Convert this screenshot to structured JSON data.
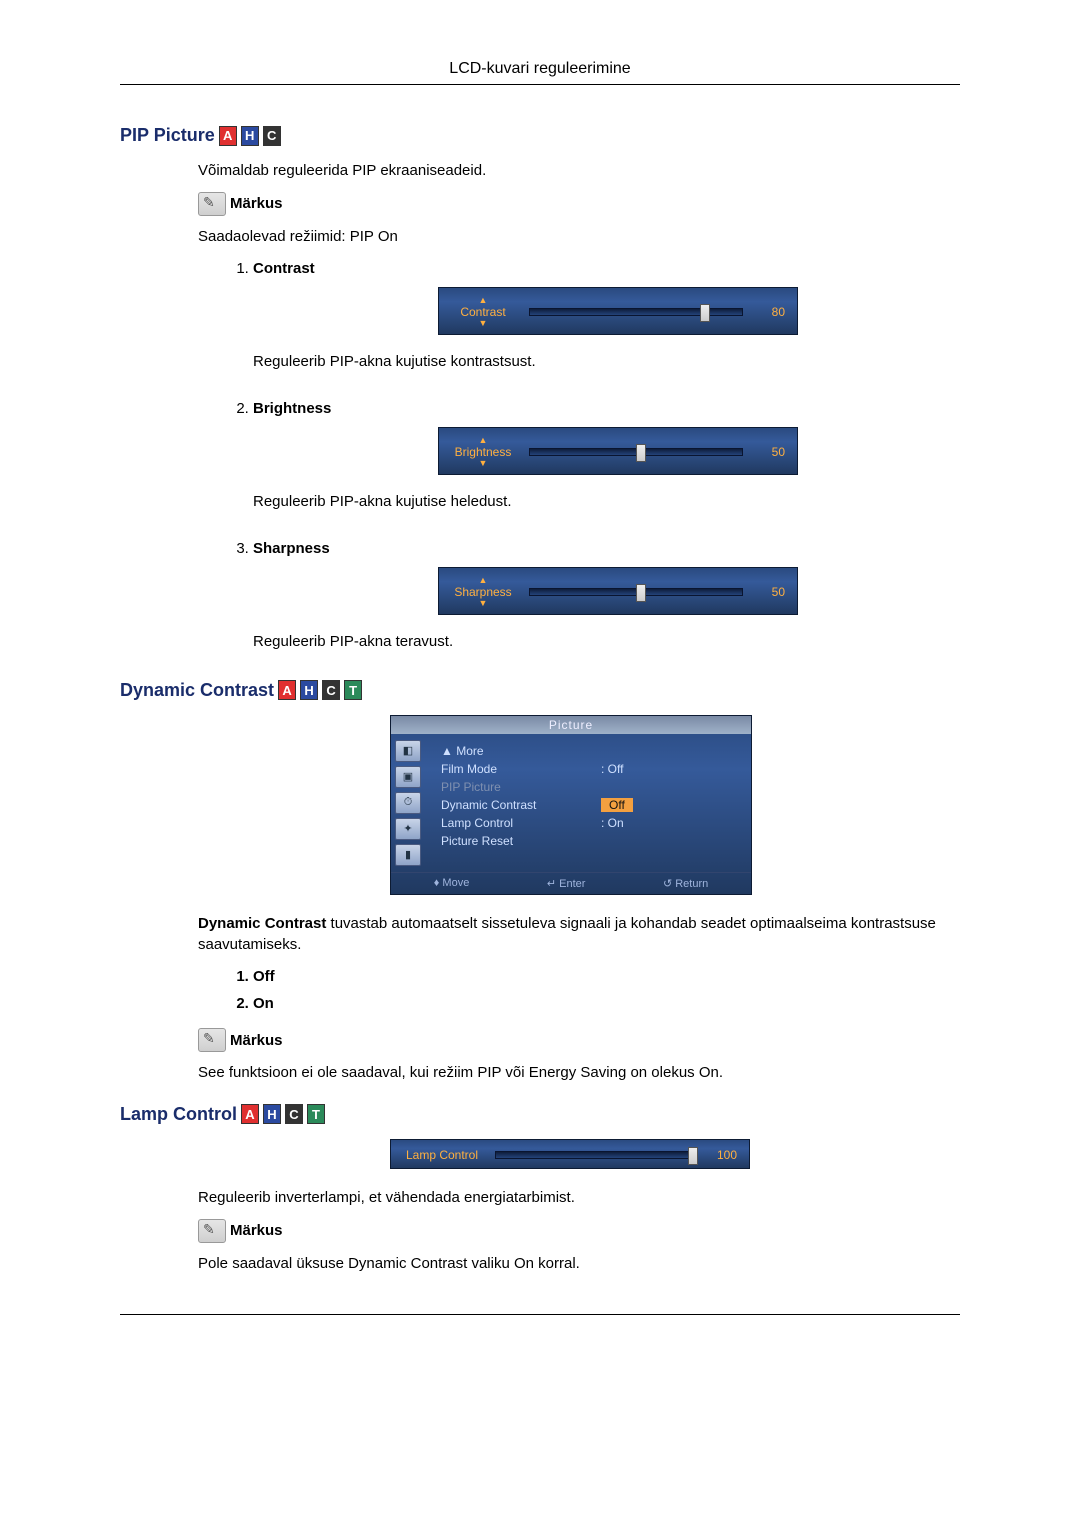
{
  "header": {
    "title": "LCD-kuvari reguleerimine"
  },
  "pip": {
    "heading": "PIP Picture",
    "badges": [
      "A",
      "H",
      "C"
    ],
    "intro": "Võimaldab reguleerida PIP ekraaniseadeid.",
    "note_label": "Märkus",
    "modes": "Saadaolevad režiimid: PIP On",
    "items": [
      {
        "title": "Contrast",
        "osd_label": "Contrast",
        "value": 80,
        "pos": 80,
        "desc": "Reguleerib PIP-akna kujutise kontrastsust."
      },
      {
        "title": "Brightness",
        "osd_label": "Brightness",
        "value": 50,
        "pos": 50,
        "desc": "Reguleerib PIP-akna kujutise heledust."
      },
      {
        "title": "Sharpness",
        "osd_label": "Sharpness",
        "value": 50,
        "pos": 50,
        "desc": "Reguleerib PIP-akna teravust."
      }
    ]
  },
  "dyn": {
    "heading": "Dynamic Contrast",
    "badges": [
      "A",
      "H",
      "C",
      "T"
    ],
    "menu": {
      "header": "Picture",
      "rows": [
        {
          "label": "▲  More",
          "val": ""
        },
        {
          "label": "Film Mode",
          "val": ": Off"
        },
        {
          "label": "PIP Picture",
          "val": "",
          "dim": true
        },
        {
          "label": "Dynamic Contrast",
          "val": "Off",
          "sel": true
        },
        {
          "label": "Lamp Control",
          "val": ": On"
        },
        {
          "label": "Picture Reset",
          "val": ""
        }
      ],
      "footer": [
        "♦ Move",
        "↵ Enter",
        "↺ Return"
      ]
    },
    "desc_prefix": "Dynamic Contrast",
    "desc_rest": " tuvastab automaatselt sissetuleva signaali ja kohandab seadet optimaalseima kontrastsuse saavutamiseks.",
    "options": [
      "Off",
      "On"
    ],
    "note_label": "Märkus",
    "note_text": "See funktsioon ei ole saadaval, kui režiim PIP või Energy Saving on olekus On."
  },
  "lamp": {
    "heading": "Lamp Control",
    "badges": [
      "A",
      "H",
      "C",
      "T"
    ],
    "osd_label": "Lamp Control",
    "value": 100,
    "pos": 97,
    "desc": "Reguleerib inverterlampi, et vähendada energiatarbimist.",
    "note_label": "Märkus",
    "note_text": "Pole saadaval üksuse Dynamic Contrast valiku On korral."
  }
}
